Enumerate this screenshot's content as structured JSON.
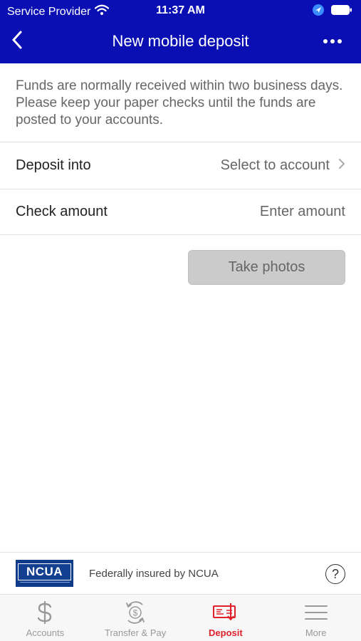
{
  "status_bar": {
    "carrier": "Service Provider",
    "time": "11:37 AM",
    "icons": [
      "wifi-icon",
      "location-arrow-icon",
      "battery-icon"
    ]
  },
  "nav": {
    "title": "New mobile deposit",
    "back_icon": "chevron-left-icon",
    "more_icon": "ellipsis-icon"
  },
  "info_text": "Funds are normally received within two business days. Please keep your paper checks until the funds are posted to your accounts.",
  "form": {
    "deposit_into": {
      "label": "Deposit into",
      "value": "Select to account"
    },
    "check_amount": {
      "label": "Check amount",
      "placeholder": "Enter amount"
    }
  },
  "take_photos_label": "Take photos",
  "footer": {
    "logo_text": "NCUA",
    "insured_text": "Federally insured by NCUA",
    "help_label": "?"
  },
  "tabs": [
    {
      "label": "Accounts",
      "icon": "dollar-icon",
      "active": false
    },
    {
      "label": "Transfer & Pay",
      "icon": "transfer-icon",
      "active": false
    },
    {
      "label": "Deposit",
      "icon": "check-deposit-icon",
      "active": true
    },
    {
      "label": "More",
      "icon": "menu-icon",
      "active": false
    }
  ],
  "colors": {
    "header_bg": "#0a0fb3",
    "active_tab": "#e0202a",
    "inactive_tab": "#999999",
    "button_disabled_bg": "#cbcbcb"
  }
}
